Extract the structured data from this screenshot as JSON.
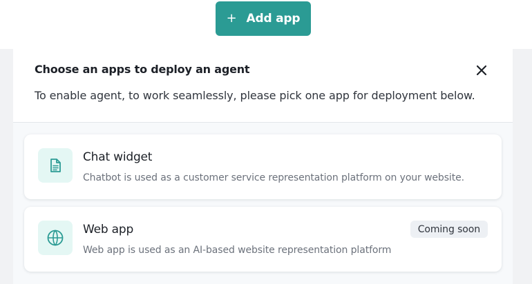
{
  "top": {
    "add_app_label": "Add app",
    "add_icon": "plus-icon"
  },
  "modal": {
    "title": "Choose an apps to deploy an agent",
    "description": "To enable agent, to work seamlessly, please pick one app for deployment below.",
    "close_icon": "close-icon"
  },
  "apps": [
    {
      "title": "Chat widget",
      "description": "Chatbot is used as a customer service representation platform on your website.",
      "icon": "document-icon"
    },
    {
      "title": "Web app",
      "description": "Web app is used as an AI-based website representation platform",
      "badge": "Coming soon",
      "icon": "globe-icon"
    }
  ],
  "colors": {
    "accent": "#2b9b94",
    "icon_bg": "#e4f7f4",
    "badge_bg": "#edf0f4",
    "backdrop": "#f1f2f4"
  }
}
